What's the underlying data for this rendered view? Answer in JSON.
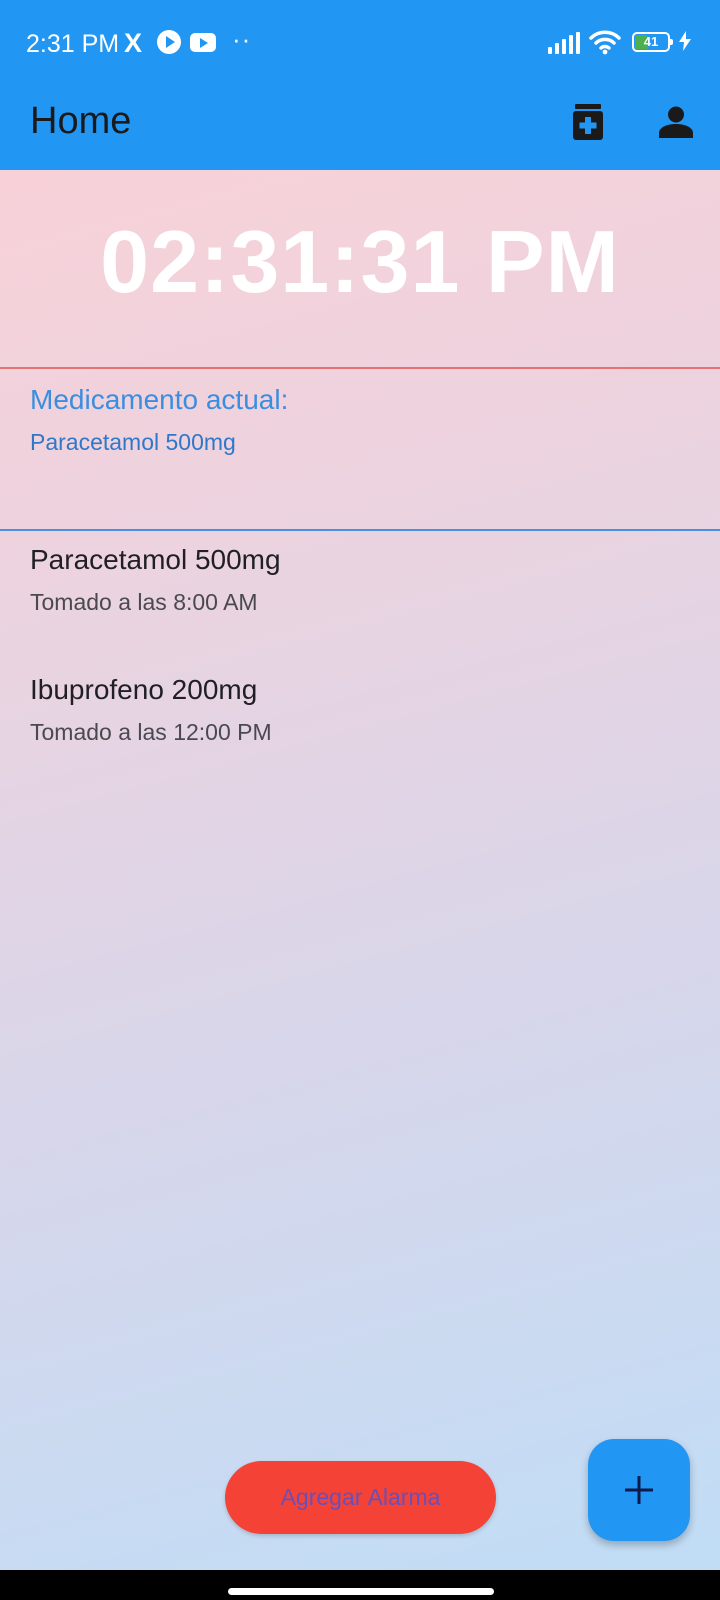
{
  "status_bar": {
    "time": "2:31 PM",
    "x_icon": "X",
    "dots": "··",
    "battery_level": "41",
    "battery_fraction": 0.41,
    "icons": [
      "x-logo-icon",
      "play-circle-icon",
      "youtube-icon",
      "more-dots-icon",
      "signal-icon",
      "wifi-icon",
      "battery-icon",
      "charging-bolt-icon"
    ]
  },
  "app_bar": {
    "title": "Home",
    "actions": [
      "medication-icon",
      "person-icon"
    ],
    "color": "#2196F3"
  },
  "clock": {
    "time": "02:31:31 PM"
  },
  "current_medication": {
    "label": "Medicamento actual:",
    "value": "Paracetamol 500mg"
  },
  "history": [
    {
      "name": "Paracetamol 500mg",
      "time": "Tomado a las 8:00 AM"
    },
    {
      "name": "Ibuprofeno 200mg",
      "time": "Tomado a las 12:00 PM"
    }
  ],
  "add_alarm_button": {
    "label": "Agregar Alarma",
    "color": "#F44336"
  },
  "fab": {
    "icon": "plus-icon",
    "color": "#2196F3"
  }
}
